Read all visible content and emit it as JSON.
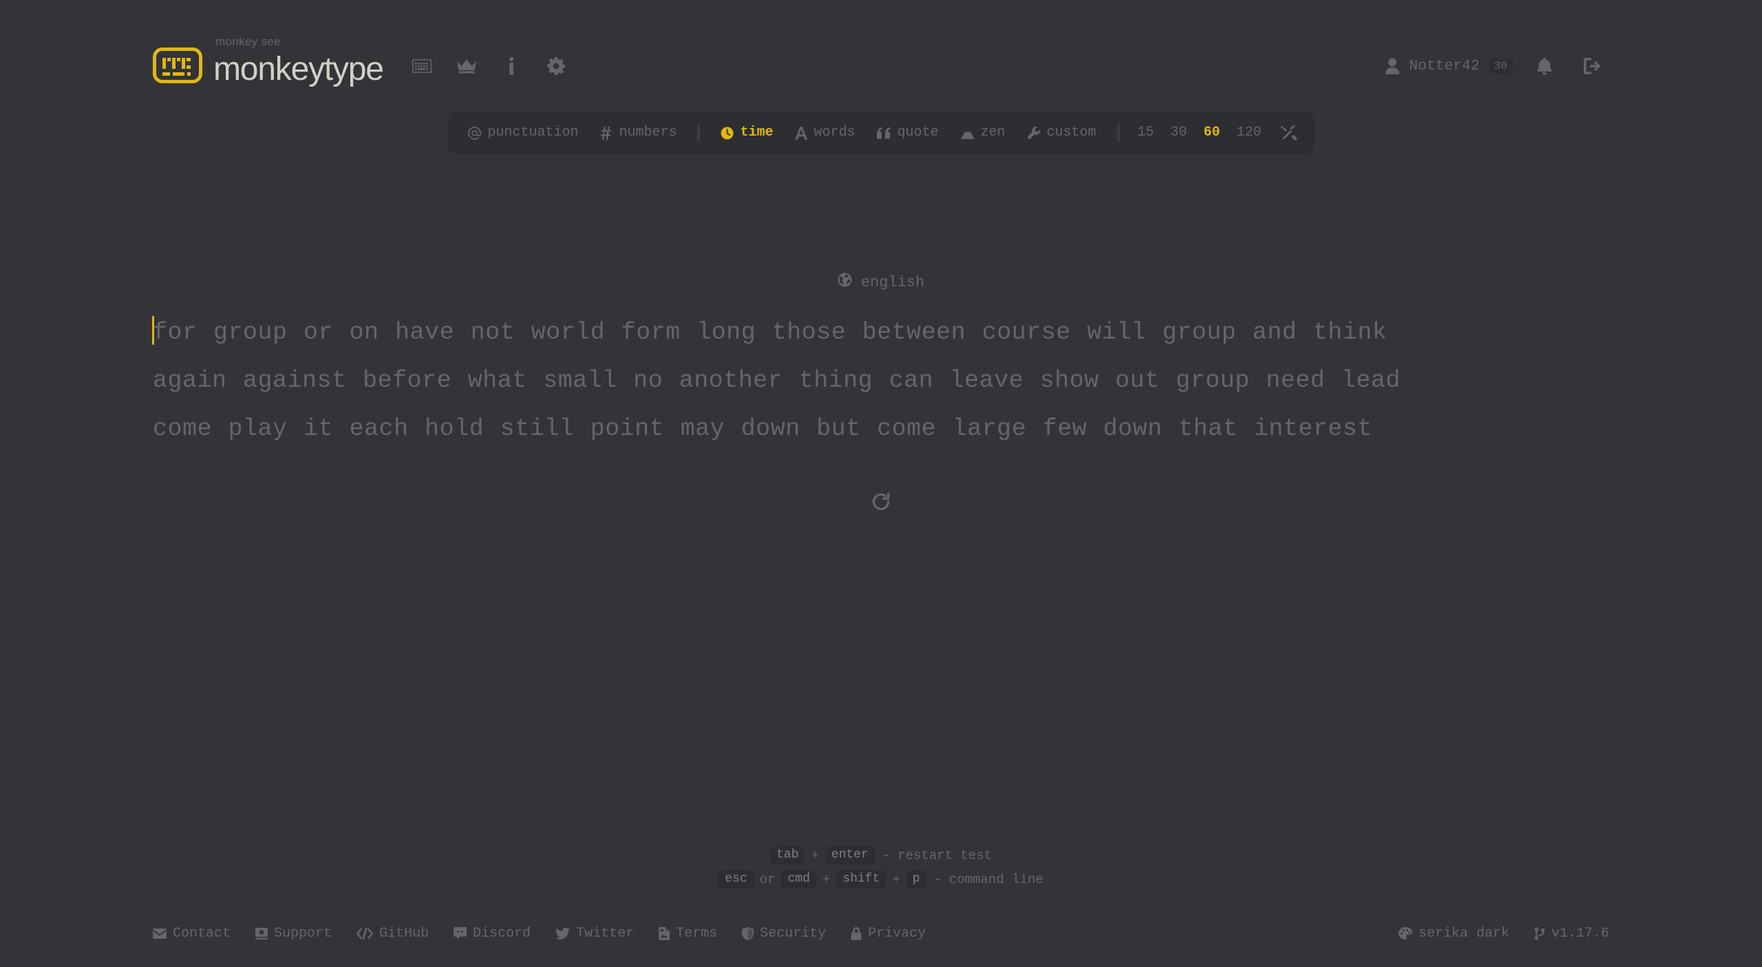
{
  "header": {
    "brand_sub": "monkey see",
    "brand_name": "monkeytype",
    "nav": [
      {
        "name": "keyboard-icon",
        "label": "keyboard"
      },
      {
        "name": "crown-icon",
        "label": "leaderboards"
      },
      {
        "name": "info-icon",
        "label": "about"
      },
      {
        "name": "gear-icon",
        "label": "settings"
      }
    ],
    "account": {
      "username": "Notter42",
      "level": "30",
      "notifications_label": "notifications",
      "signout_label": "sign out"
    }
  },
  "config": {
    "modifiers": [
      {
        "icon": "at-icon",
        "label": "punctuation",
        "active": false
      },
      {
        "icon": "hash-icon",
        "label": "numbers",
        "active": false
      }
    ],
    "modes": [
      {
        "icon": "clock-icon",
        "label": "time",
        "active": true
      },
      {
        "icon": "letter-a-icon",
        "label": "words",
        "active": false
      },
      {
        "icon": "quote-icon",
        "label": "quote",
        "active": false
      },
      {
        "icon": "mountain-icon",
        "label": "zen",
        "active": false
      },
      {
        "icon": "wrench-icon",
        "label": "custom",
        "active": false
      }
    ],
    "amounts": [
      {
        "label": "15",
        "active": false
      },
      {
        "label": "30",
        "active": false
      },
      {
        "label": "60",
        "active": true
      },
      {
        "label": "120",
        "active": false
      }
    ],
    "tools_label": "custom settings"
  },
  "test": {
    "language": "english",
    "lines": [
      "for group or on have not world form long those between course will group and think",
      "again against before what small no another thing can leave show out group need lead",
      "come play it each hold still point may down but come large few down that interest"
    ],
    "restart_label": "restart test"
  },
  "hints": {
    "line1": {
      "key1": "tab",
      "plus": "+",
      "key2": "enter",
      "dash": "-",
      "action": "restart test"
    },
    "line2": {
      "key1": "esc",
      "or": "or",
      "key2": "cmd",
      "plus1": "+",
      "key3": "shift",
      "plus2": "+",
      "key4": "p",
      "dash": "-",
      "action": "command line"
    }
  },
  "footer": {
    "left": [
      {
        "icon": "envelope-icon",
        "label": "Contact"
      },
      {
        "icon": "money-icon",
        "label": "Support"
      },
      {
        "icon": "code-icon",
        "label": "GitHub"
      },
      {
        "icon": "discord-icon",
        "label": "Discord"
      },
      {
        "icon": "twitter-icon",
        "label": "Twitter"
      },
      {
        "icon": "document-icon",
        "label": "Terms"
      },
      {
        "icon": "shield-icon",
        "label": "Security"
      },
      {
        "icon": "lock-icon",
        "label": "Privacy"
      }
    ],
    "right": [
      {
        "icon": "palette-icon",
        "label": "serika dark"
      },
      {
        "icon": "git-branch-icon",
        "label": "v1.17.6"
      }
    ]
  },
  "colors": {
    "background": "#323437",
    "sub": "#646669",
    "text": "#d1d0c5",
    "accent": "#e2b714",
    "panel": "#2c2e31"
  }
}
